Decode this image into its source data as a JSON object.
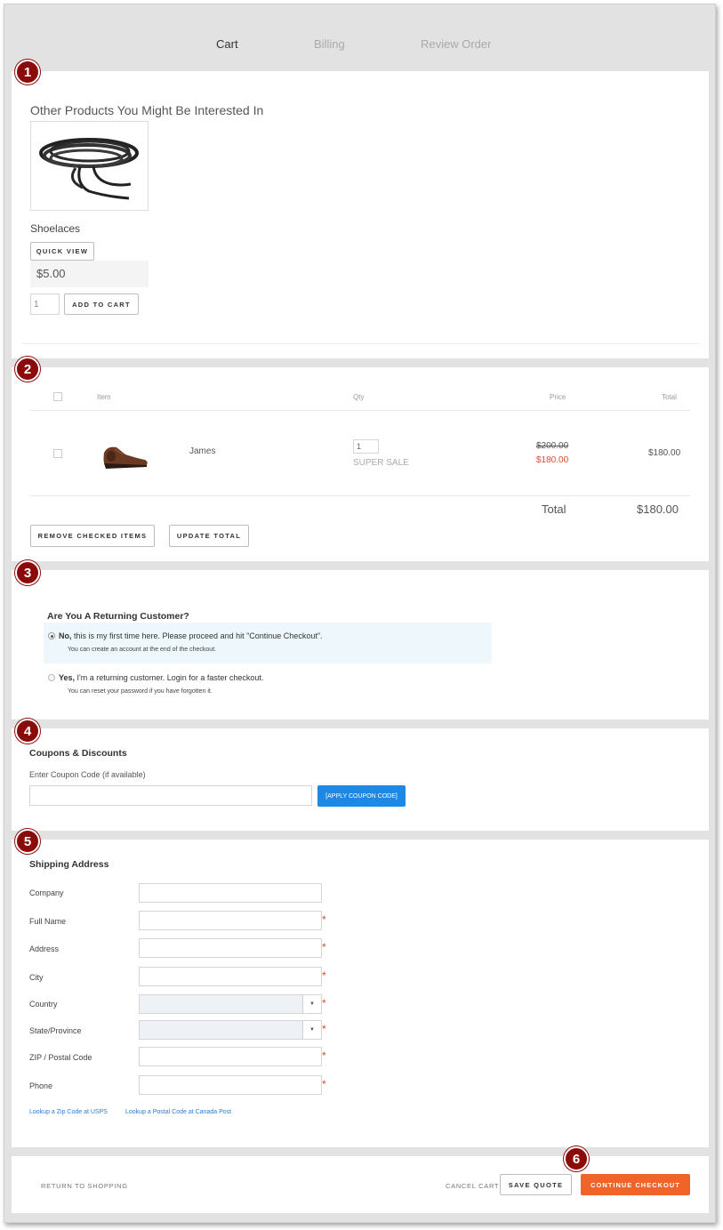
{
  "steps": {
    "cart": "Cart",
    "billing": "Billing",
    "review": "Review Order"
  },
  "badges": [
    "1",
    "2",
    "3",
    "4",
    "5",
    "6"
  ],
  "recommendations": {
    "title": "Other Products You Might Be Interested In",
    "product_name": "Shoelaces",
    "quick_view": "QUICK VIEW",
    "price": "$5.00",
    "qty": "1",
    "add_to_cart": "ADD TO CART"
  },
  "cart": {
    "headers": {
      "item": "Item",
      "qty": "Qty",
      "price": "Price",
      "total": "Total"
    },
    "row": {
      "name": "James",
      "qty": "1",
      "promo": "SUPER SALE",
      "old_price": "$200.00",
      "sale_price": "$180.00",
      "total": "$180.00"
    },
    "total_label": "Total",
    "total_value": "$180.00",
    "remove_btn": "REMOVE CHECKED ITEMS",
    "update_btn": "UPDATE TOTAL"
  },
  "returning": {
    "title": "Are You A Returning Customer?",
    "no_bold": "No,",
    "no_text": " this is my first time here. Please proceed and hit \"Continue Checkout\".",
    "no_sub": "You can create an account at the end of the checkout.",
    "yes_bold": "Yes,",
    "yes_text": " I'm a returning customer. Login for a faster checkout.",
    "yes_sub": "You can reset your password if you have forgotten it."
  },
  "coupons": {
    "title": "Coupons & Discounts",
    "label": "Enter Coupon Code (if available)",
    "apply_btn": "[APPLY COUPON CODE]"
  },
  "shipping": {
    "title": "Shipping Address",
    "fields": {
      "company": "Company",
      "full_name": "Full Name",
      "address": "Address",
      "city": "City",
      "country": "Country",
      "state": "State/Province",
      "zip": "ZIP / Postal Code",
      "phone": "Phone"
    },
    "required_mark": "*",
    "usps_link": "Lookup a Zip Code at USPS",
    "canada_link": "Lookup a Postal Code at Canada Post"
  },
  "footer": {
    "return": "RETURN TO SHOPPING",
    "cancel": "CANCEL CART",
    "save": "SAVE QUOTE",
    "continue": "CONTINUE CHECKOUT"
  },
  "colors": {
    "accent_orange": "#f0642a",
    "apply_blue": "#1e88e5",
    "badge_red": "#8b0b0b",
    "sale_red": "#e04a2a",
    "link_blue": "#2a7bd5"
  }
}
